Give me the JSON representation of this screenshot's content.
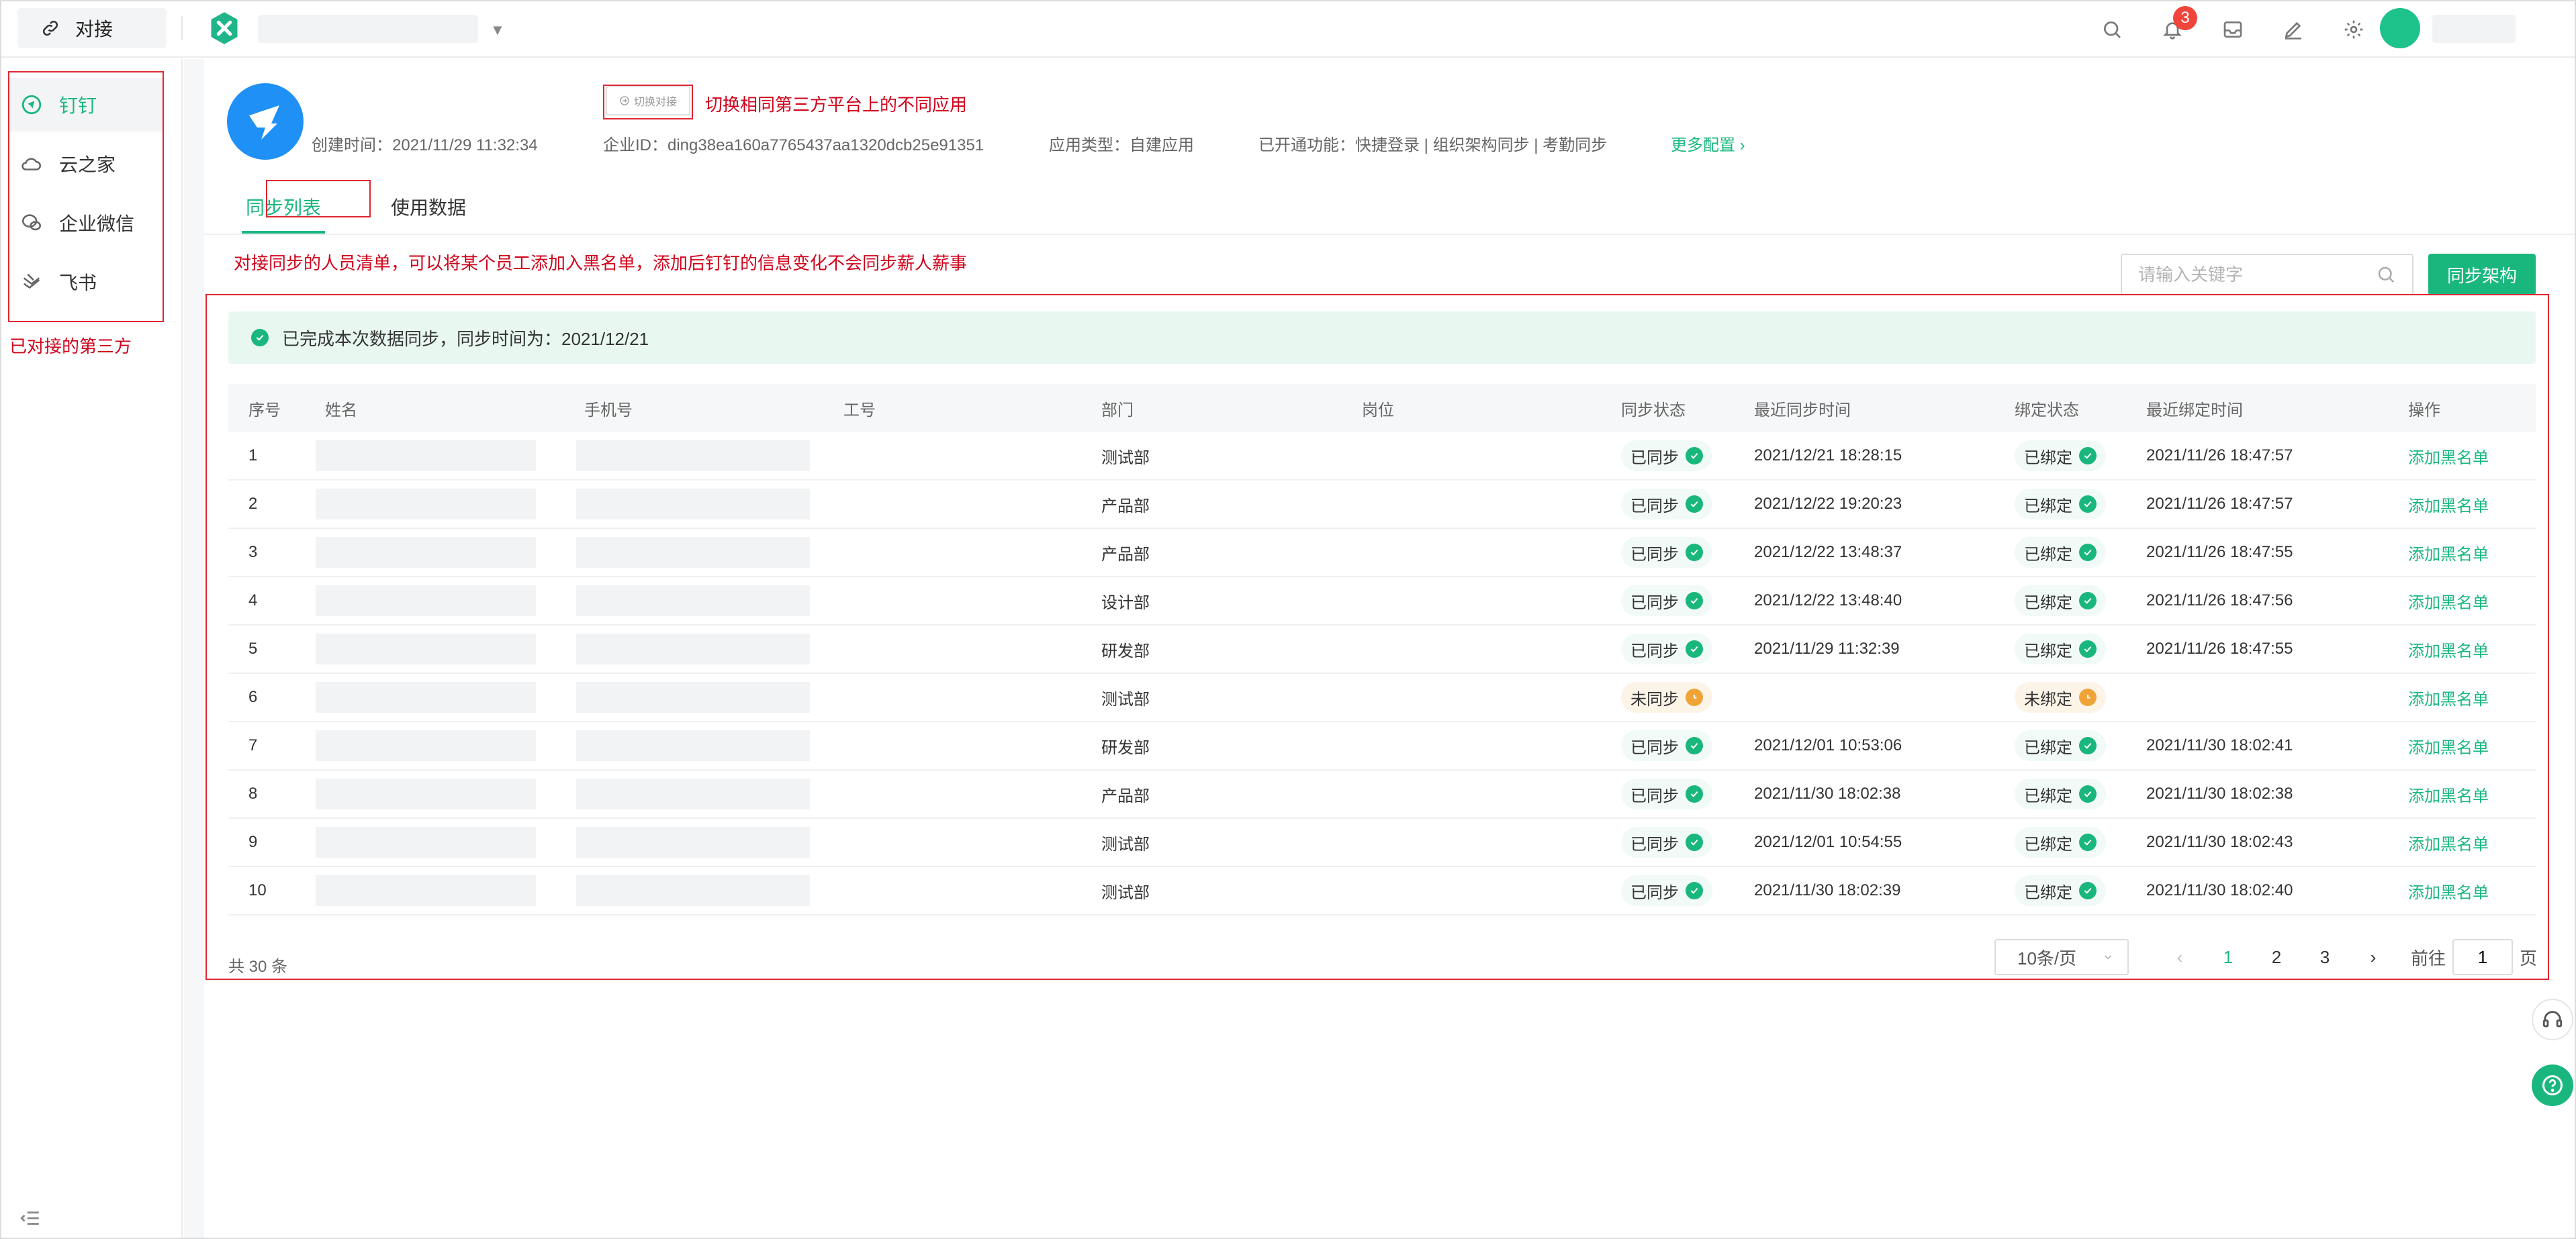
{
  "topbar": {
    "home_label": "对接",
    "notification_count": "3"
  },
  "sidebar": {
    "items": [
      {
        "label": "钉钉",
        "icon": "dingtalk-icon",
        "active": true
      },
      {
        "label": "云之家",
        "icon": "cloud-icon",
        "active": false
      },
      {
        "label": "企业微信",
        "icon": "wecom-icon",
        "active": false
      },
      {
        "label": "飞书",
        "icon": "feishu-icon",
        "active": false
      }
    ]
  },
  "app": {
    "switch_label": "切换对接",
    "created": "创建时间：2021/11/29 11:32:34",
    "enterprise_id": "企业ID：ding38ea160a7765437aa1320dcb25e91351",
    "app_type": "应用类型：自建应用",
    "features": "已开通功能：快捷登录 | 组织架构同步 | 考勤同步",
    "more": "更多配置 ›"
  },
  "tabs": [
    {
      "label": "同步列表",
      "active": true
    },
    {
      "label": "使用数据",
      "active": false
    }
  ],
  "toolbar": {
    "search_placeholder": "请输入关键字",
    "sync_button": "同步架构"
  },
  "notice": "已完成本次数据同步，同步时间为：2021/12/21",
  "table": {
    "headers": {
      "index": "序号",
      "name": "姓名",
      "phone": "手机号",
      "job_no": "工号",
      "dept": "部门",
      "position": "岗位",
      "sync_status": "同步状态",
      "last_sync": "最近同步时间",
      "bind_status": "绑定状态",
      "last_bind": "最近绑定时间",
      "action": "操作"
    },
    "rows": [
      {
        "index": "1",
        "dept": "测试部",
        "sync": "已同步",
        "sync_ok": true,
        "last_sync": "2021/12/21 18:28:15",
        "bind": "已绑定",
        "bind_ok": true,
        "last_bind": "2021/11/26 18:47:57",
        "action": "添加黑名单"
      },
      {
        "index": "2",
        "dept": "产品部",
        "sync": "已同步",
        "sync_ok": true,
        "last_sync": "2021/12/22 19:20:23",
        "bind": "已绑定",
        "bind_ok": true,
        "last_bind": "2021/11/26 18:47:57",
        "action": "添加黑名单"
      },
      {
        "index": "3",
        "dept": "产品部",
        "sync": "已同步",
        "sync_ok": true,
        "last_sync": "2021/12/22 13:48:37",
        "bind": "已绑定",
        "bind_ok": true,
        "last_bind": "2021/11/26 18:47:55",
        "action": "添加黑名单"
      },
      {
        "index": "4",
        "dept": "设计部",
        "sync": "已同步",
        "sync_ok": true,
        "last_sync": "2021/12/22 13:48:40",
        "bind": "已绑定",
        "bind_ok": true,
        "last_bind": "2021/11/26 18:47:56",
        "action": "添加黑名单"
      },
      {
        "index": "5",
        "dept": "研发部",
        "sync": "已同步",
        "sync_ok": true,
        "last_sync": "2021/11/29 11:32:39",
        "bind": "已绑定",
        "bind_ok": true,
        "last_bind": "2021/11/26 18:47:55",
        "action": "添加黑名单"
      },
      {
        "index": "6",
        "dept": "测试部",
        "sync": "未同步",
        "sync_ok": false,
        "last_sync": "",
        "bind": "未绑定",
        "bind_ok": false,
        "last_bind": "",
        "action": "添加黑名单"
      },
      {
        "index": "7",
        "dept": "研发部",
        "sync": "已同步",
        "sync_ok": true,
        "last_sync": "2021/12/01 10:53:06",
        "bind": "已绑定",
        "bind_ok": true,
        "last_bind": "2021/11/30 18:02:41",
        "action": "添加黑名单"
      },
      {
        "index": "8",
        "dept": "产品部",
        "sync": "已同步",
        "sync_ok": true,
        "last_sync": "2021/11/30 18:02:38",
        "bind": "已绑定",
        "bind_ok": true,
        "last_bind": "2021/11/30 18:02:38",
        "action": "添加黑名单"
      },
      {
        "index": "9",
        "dept": "测试部",
        "sync": "已同步",
        "sync_ok": true,
        "last_sync": "2021/12/01 10:54:55",
        "bind": "已绑定",
        "bind_ok": true,
        "last_bind": "2021/11/30 18:02:43",
        "action": "添加黑名单"
      },
      {
        "index": "10",
        "dept": "测试部",
        "sync": "已同步",
        "sync_ok": true,
        "last_sync": "2021/11/30 18:02:39",
        "bind": "已绑定",
        "bind_ok": true,
        "last_bind": "2021/11/30 18:02:40",
        "action": "添加黑名单"
      }
    ]
  },
  "pagination": {
    "total": "共 30 条",
    "page_size": "10条/页",
    "pages": [
      "1",
      "2",
      "3"
    ],
    "current": "1",
    "goto_prefix": "前往",
    "goto_value": "1",
    "goto_suffix": "页"
  },
  "annotations": {
    "switch_note": "切换相同第三方平台上的不同应用",
    "sidebar_note": "已对接的第三方",
    "list_note": "对接同步的人员清单，可以将某个员工添加入黑名单，添加后钉钉的信息变化不会同步薪人薪事"
  },
  "colors": {
    "accent": "#19b77e",
    "annotation": "#e02632",
    "badge": "#f0453b",
    "pending": "#f0a437",
    "dingtalk_blue": "#1e90f6"
  }
}
